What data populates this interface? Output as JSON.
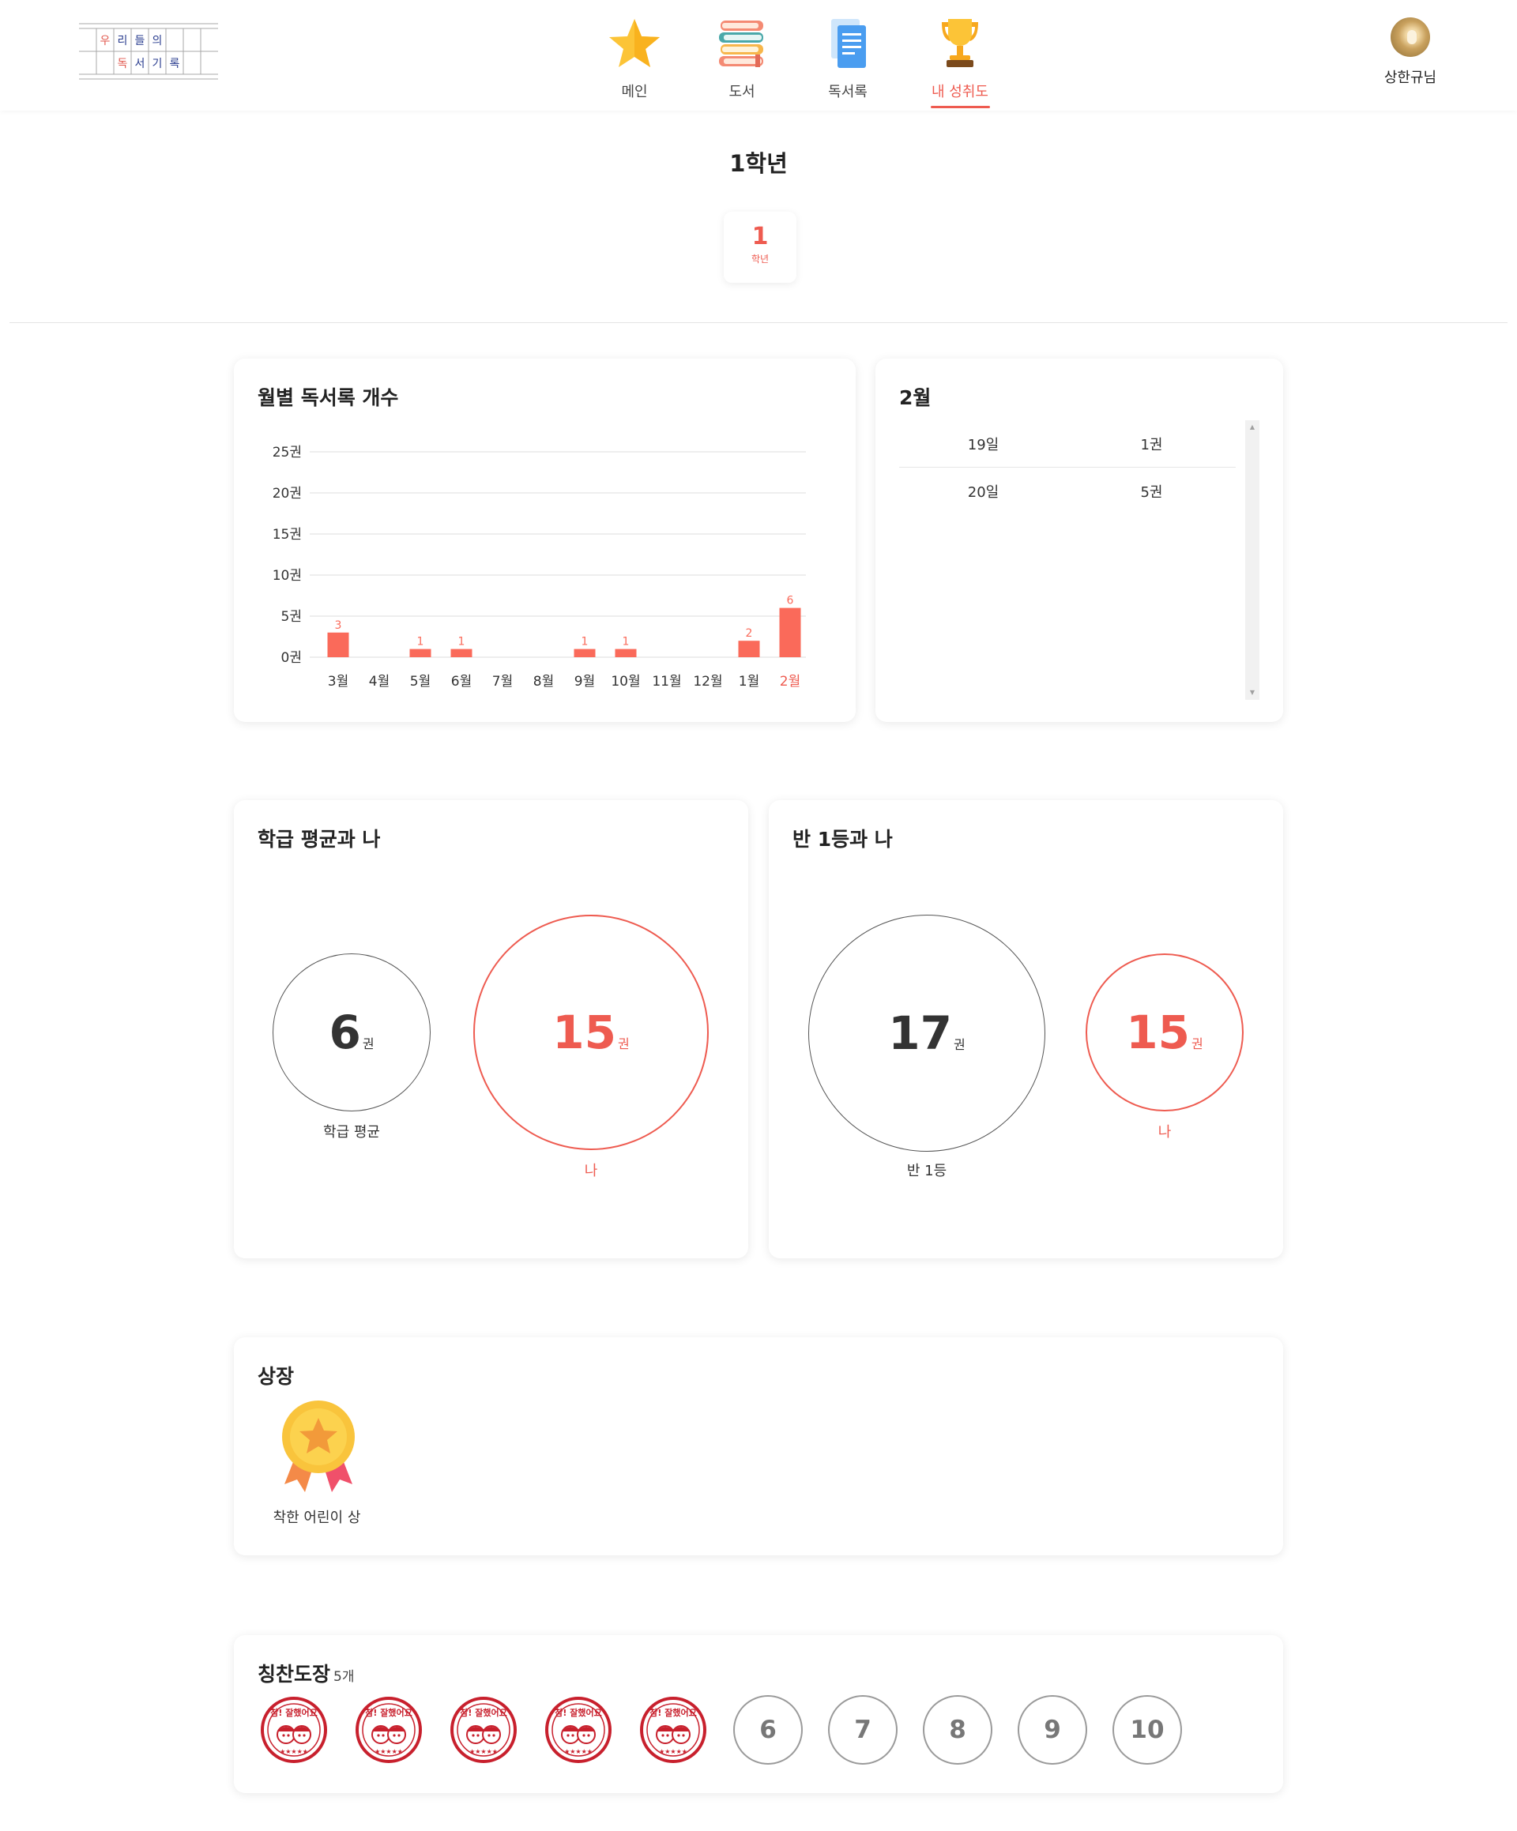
{
  "header": {
    "logo_chars": [
      "우",
      "리",
      "들",
      "의",
      "독",
      "서",
      "기",
      "록"
    ],
    "nav": [
      {
        "label": "메인",
        "icon": "star-icon"
      },
      {
        "label": "도서",
        "icon": "books-icon"
      },
      {
        "label": "독서록",
        "icon": "document-icon"
      },
      {
        "label": "내 성취도",
        "icon": "trophy-icon",
        "active": true
      }
    ],
    "user_name": "상한규님"
  },
  "grade": {
    "title": "1학년",
    "chip_num": "1",
    "chip_unit": "학년"
  },
  "monthly": {
    "title": "월별 독서록 개수"
  },
  "chart_data": {
    "type": "bar",
    "title": "월별 독서록 개수",
    "categories": [
      "3월",
      "4월",
      "5월",
      "6월",
      "7월",
      "8월",
      "9월",
      "10월",
      "11월",
      "12월",
      "1월",
      "2월"
    ],
    "values": [
      3,
      0,
      1,
      1,
      0,
      0,
      1,
      1,
      0,
      0,
      2,
      6
    ],
    "ylim": [
      0,
      25
    ],
    "yticks": [
      "0권",
      "5권",
      "10권",
      "15권",
      "20권",
      "25권"
    ],
    "grid": true,
    "highlight": "2월",
    "color": "#fa6a5a"
  },
  "daily": {
    "title": "2월",
    "rows": [
      {
        "day": "19일",
        "count": "1권"
      },
      {
        "day": "20일",
        "count": "5권"
      }
    ]
  },
  "class_avg": {
    "title": "학급 평균과 나",
    "avg_value": "6",
    "avg_unit": "권",
    "avg_label": "학급 평균",
    "me_value": "15",
    "me_unit": "권",
    "me_label": "나"
  },
  "class_top": {
    "title": "반 1등과 나",
    "top_value": "17",
    "top_unit": "권",
    "top_label": "반 1등",
    "me_value": "15",
    "me_unit": "권",
    "me_label": "나"
  },
  "awards": {
    "title": "상장",
    "items": [
      {
        "name": "착한 어린이 상",
        "icon": "medal-icon"
      }
    ]
  },
  "stamps": {
    "title": "칭찬도장",
    "count_text": "5개",
    "filled_count": 5,
    "stamp_text": "참! 잘했어요",
    "empty": [
      "6",
      "7",
      "8",
      "9",
      "10"
    ]
  },
  "colors": {
    "accent": "#ee5b50",
    "bar": "#fa6a5a",
    "stamp": "#c8202d"
  }
}
